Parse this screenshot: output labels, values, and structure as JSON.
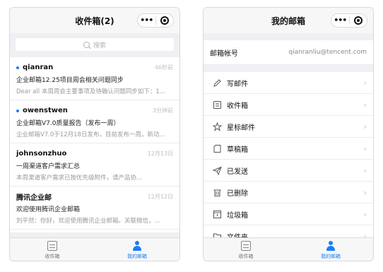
{
  "left": {
    "title": "收件箱(2)",
    "search_placeholder": "搜索",
    "mails": [
      {
        "sender": "qianran",
        "unread": true,
        "time": "46秒前",
        "subject": "企业邮箱12.25项目周会相关问题同步",
        "preview": "Dear all 本周周会主要事项及待确认问题同步如下：1..."
      },
      {
        "sender": "owenstwen",
        "unread": true,
        "time": "3分钟前",
        "subject": "企业邮箱V7.0质量报告（发布一周）",
        "preview": "企业邮箱V7.0于12月18日发布，目前发布一周，新功..."
      },
      {
        "sender": "johnsonzhuo",
        "unread": false,
        "time": "12月13日",
        "subject": "一周渠道客户需求汇总",
        "preview": "本周渠道客户需求已按优先级附件，请产品协..."
      },
      {
        "sender": "腾讯企业邮",
        "unread": false,
        "time": "12月12日",
        "subject": "欢迎使用腾讯企业邮箱",
        "preview": "刘平然：你好，欢迎使用腾讯企业邮箱。关联微信，..."
      }
    ]
  },
  "right": {
    "title": "我的邮箱",
    "account_label": "邮箱帐号",
    "account_value": "qianranliu@tencent.com",
    "menu": [
      {
        "label": "写邮件",
        "icon": "pen-icon"
      },
      {
        "label": "收件箱",
        "icon": "inbox-icon"
      },
      {
        "label": "星标邮件",
        "icon": "star-icon"
      },
      {
        "label": "草稿箱",
        "icon": "draft-icon"
      },
      {
        "label": "已发送",
        "icon": "send-icon"
      },
      {
        "label": "已删除",
        "icon": "trash-icon"
      },
      {
        "label": "垃圾箱",
        "icon": "spam-icon"
      },
      {
        "label": "文件夹",
        "icon": "folder-icon"
      }
    ]
  },
  "tabbar": {
    "inbox_label": "收件箱",
    "mine_label": "我的邮箱"
  },
  "colors": {
    "accent": "#1a7dfa",
    "background": "#efeff4"
  }
}
